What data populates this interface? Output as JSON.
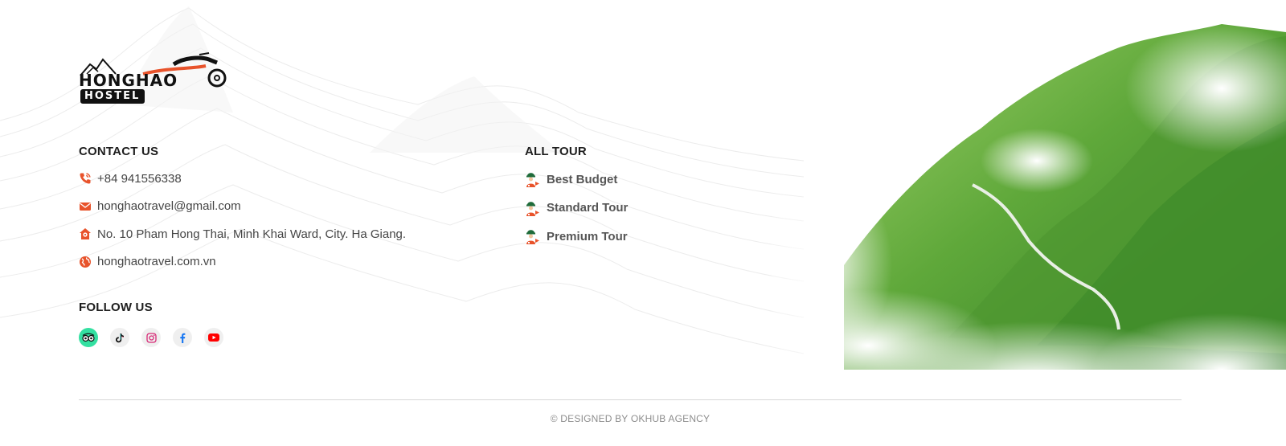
{
  "logo": {
    "brand": "HONGHAO",
    "sub": "HOSTEL"
  },
  "contact": {
    "title": "CONTACT US",
    "items": [
      {
        "icon": "phone-icon",
        "text": "+84 941556338"
      },
      {
        "icon": "mail-icon",
        "text": "honghaotravel@gmail.com"
      },
      {
        "icon": "home-location-icon",
        "text": "No. 10 Pham Hong Thai, Minh Khai Ward, City.  Ha Giang."
      },
      {
        "icon": "globe-icon",
        "text": "honghaotravel.com.vn"
      }
    ]
  },
  "tours": {
    "title": "ALL TOUR",
    "items": [
      {
        "icon": "tour-guide-icon",
        "label": "Best Budget"
      },
      {
        "icon": "tour-guide-icon",
        "label": "Standard Tour"
      },
      {
        "icon": "tour-guide-icon",
        "label": "Premium Tour"
      }
    ]
  },
  "follow": {
    "title": "FOLLOW US",
    "socials": [
      {
        "name": "tripadvisor-icon",
        "color": "#34e0a1"
      },
      {
        "name": "tiktok-icon",
        "color": "#111111"
      },
      {
        "name": "instagram-icon",
        "color": "#d62976"
      },
      {
        "name": "facebook-icon",
        "color": "#1877f2"
      },
      {
        "name": "youtube-icon",
        "color": "#ff0000"
      }
    ]
  },
  "colors": {
    "accent": "#e8532b",
    "tour_icon_green": "#1f6b3a"
  },
  "footer": {
    "copyright": "© DESIGNED BY OKHUB AGENCY"
  }
}
